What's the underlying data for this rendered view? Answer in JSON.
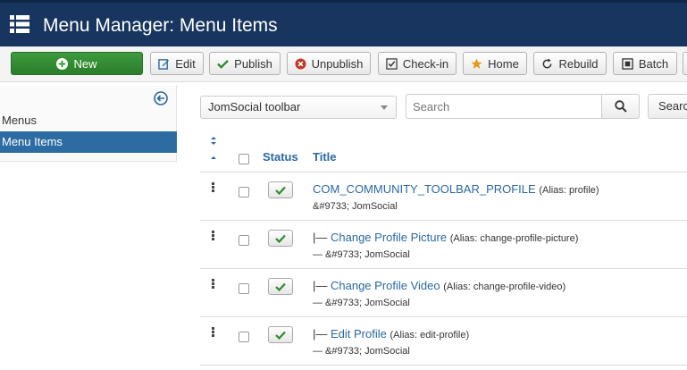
{
  "header": {
    "title": "Menu Manager: Menu Items",
    "menu_icon": "list-icon"
  },
  "toolbar": {
    "buttons": [
      {
        "label": "New",
        "icon": "plus-circle-icon"
      },
      {
        "label": "Edit",
        "icon": "edit-icon"
      },
      {
        "label": "Publish",
        "icon": "check-icon"
      },
      {
        "label": "Unpublish",
        "icon": "unpublish-icon"
      },
      {
        "label": "Check-in",
        "icon": "checkbox-icon"
      },
      {
        "label": "Home",
        "icon": "star-icon"
      },
      {
        "label": "Rebuild",
        "icon": "refresh-icon"
      },
      {
        "label": "Batch",
        "icon": "batch-icon"
      }
    ]
  },
  "sidebar": {
    "items": [
      {
        "label": "Menus"
      },
      {
        "label": "Menu Items"
      }
    ]
  },
  "filters": {
    "menu_select": "JomSocial toolbar",
    "search_placeholder": "Search",
    "search_tools_label": "Search"
  },
  "table": {
    "headers": {
      "status": "Status",
      "title": "Title"
    },
    "rows": [
      {
        "prefix": "",
        "title": "COM_COMMUNITY_TOOLBAR_PROFILE",
        "alias": "(Alias: profile)",
        "menu": "&#9733; JomSocial"
      },
      {
        "prefix": "|— ",
        "title": "Change Profile Picture",
        "alias": "(Alias: change-profile-picture)",
        "menu": "— &#9733; JomSocial"
      },
      {
        "prefix": "|— ",
        "title": "Change Profile Video",
        "alias": "(Alias: change-profile-video)",
        "menu": "— &#9733; JomSocial"
      },
      {
        "prefix": "|— ",
        "title": "Edit Profile",
        "alias": "(Alias: edit-profile)",
        "menu": "— &#9733; JomSocial"
      }
    ]
  },
  "colors": {
    "header_bg": "#17355e",
    "new_button": "#339933",
    "link": "#2a69a0",
    "active_sidebar": "#2d6ca2",
    "published_check": "#2e8b2e"
  }
}
